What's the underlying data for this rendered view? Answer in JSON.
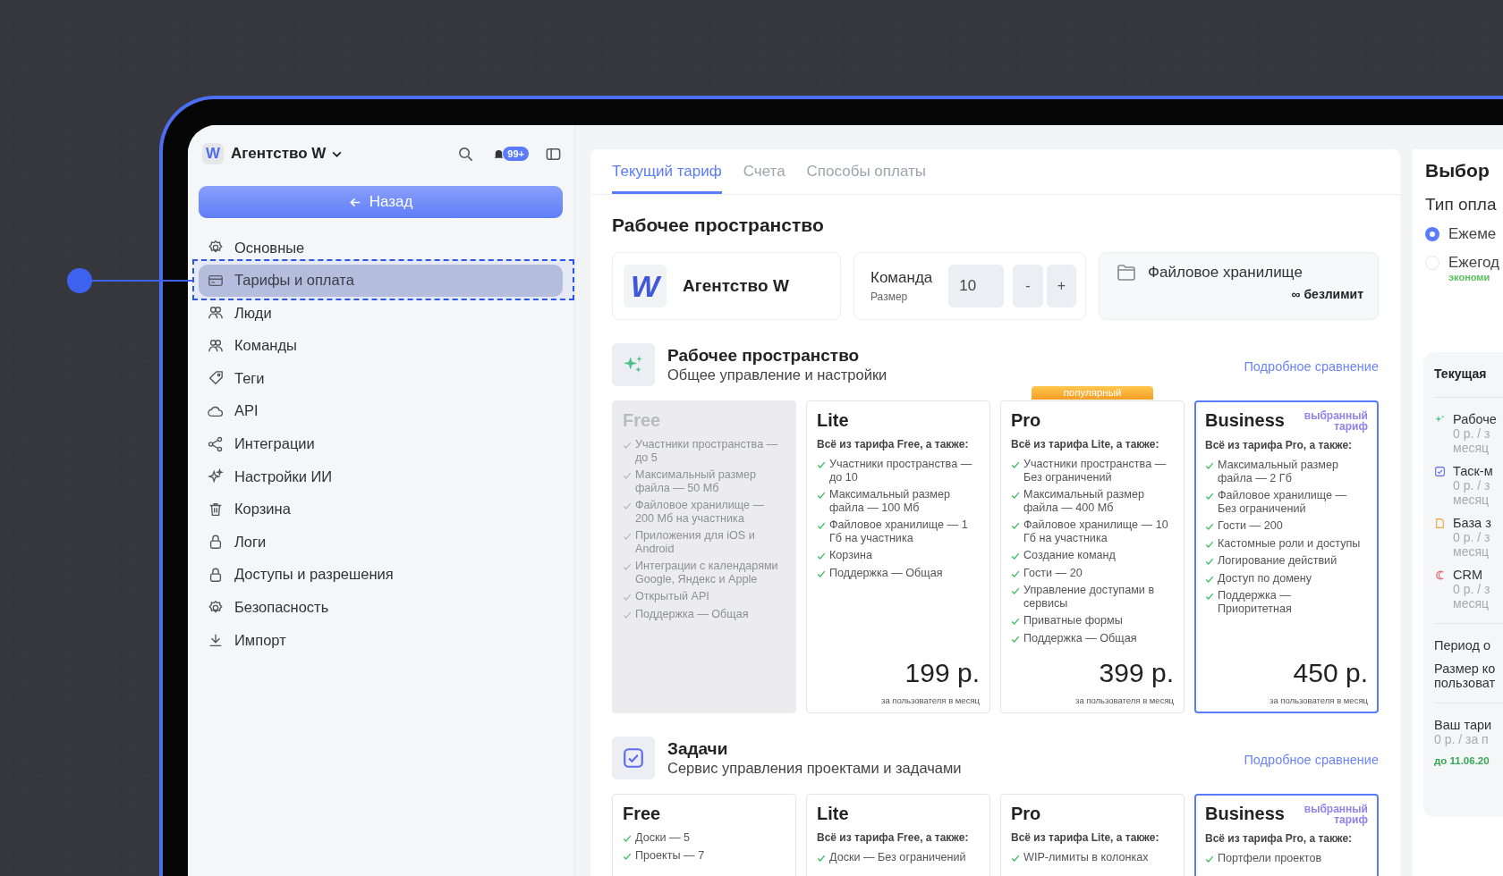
{
  "sidebar": {
    "logo": "W",
    "workspace": "Агентство W",
    "notifications": "99+",
    "back": "Назад",
    "items": [
      {
        "label": "Основные",
        "selected": false
      },
      {
        "label": "Тарифы и оплата",
        "selected": true
      },
      {
        "label": "Люди",
        "selected": false
      },
      {
        "label": "Команды",
        "selected": false
      },
      {
        "label": "Теги",
        "selected": false
      },
      {
        "label": "API",
        "selected": false
      },
      {
        "label": "Интеграции",
        "selected": false
      },
      {
        "label": "Настройки ИИ",
        "selected": false
      },
      {
        "label": "Корзина",
        "selected": false
      },
      {
        "label": "Логи",
        "selected": false
      },
      {
        "label": "Доступы и разрешения",
        "selected": false
      },
      {
        "label": "Безопасность",
        "selected": false
      },
      {
        "label": "Импорт",
        "selected": false
      }
    ]
  },
  "tabs": [
    {
      "label": "Текущий тариф",
      "selected": true
    },
    {
      "label": "Счета",
      "selected": false
    },
    {
      "label": "Способы оплаты",
      "selected": false
    }
  ],
  "workspace": {
    "heading": "Рабочее пространство",
    "logo": "W",
    "name": "Агентство W",
    "team": {
      "label": "Команда",
      "sublabel": "Размер",
      "value": "10",
      "minus": "-",
      "plus": "+"
    },
    "storage": {
      "label": "Файловое хранилище",
      "value": "∞ безлимит"
    }
  },
  "sections": [
    {
      "kind": "workspace",
      "title": "Рабочее пространство",
      "subtitle": "Общее управление и настройки",
      "link": "Подробное сравнение",
      "plans": [
        {
          "name": "Free",
          "disabled": true,
          "selected": false,
          "features": [
            "Участники пространства — до 5",
            "Максимальный размер файла — 50 Мб",
            "Файловое хранилище — 200 Мб на участника",
            "Приложения для iOS и Android",
            "Интеграции с календарями Google, Яндекс и Apple",
            "Открытый API",
            "Поддержка — Общая"
          ]
        },
        {
          "name": "Lite",
          "disabled": false,
          "selected": false,
          "subtitle": "Всё из тарифа Free, а также:",
          "features": [
            "Участники пространства — до 10",
            "Максимальный размер файла — 100 Мб",
            "Файловое хранилище — 1 Гб на участника",
            "Корзина",
            "Поддержка — Общая"
          ],
          "price": "199 р.",
          "price_note": "за пользователя в месяц"
        },
        {
          "name": "Pro",
          "disabled": false,
          "selected": false,
          "badge": "популярный",
          "subtitle": "Всё из тарифа Lite, а также:",
          "features": [
            "Участники пространства — Без ограничений",
            "Максимальный размер файла — 400 Мб",
            "Файловое хранилище — 10 Гб на участника",
            "Создание команд",
            "Гости — 20",
            "Управление доступами в сервисы",
            "Приватные формы",
            "Поддержка — Общая"
          ],
          "price": "399 р.",
          "price_note": "за пользователя в месяц"
        },
        {
          "name": "Business",
          "disabled": false,
          "selected": true,
          "selected_label": "выбранный тариф",
          "subtitle": "Всё из тарифа Pro, а также:",
          "features": [
            "Максимальный размер файла — 2 Гб",
            "Файловое хранилище — Без ограничений",
            "Гости — 200",
            "Кастомные роли и доступы",
            "Логирование действий",
            "Доступ по домену",
            "Поддержка — Приоритетная"
          ],
          "price": "450 р.",
          "price_note": "за пользователя в месяц"
        }
      ]
    },
    {
      "kind": "tasks",
      "title": "Задачи",
      "subtitle": "Сервис управления проектами и задачами",
      "link": "Подробное сравнение",
      "plans": [
        {
          "name": "Free",
          "disabled": false,
          "selected": false,
          "features": [
            "Доски — 5",
            "Проекты — 7"
          ]
        },
        {
          "name": "Lite",
          "disabled": false,
          "selected": false,
          "subtitle": "Всё из тарифа Free, а также:",
          "features": [
            "Доски — Без ограничений"
          ]
        },
        {
          "name": "Pro",
          "disabled": false,
          "selected": false,
          "subtitle": "Всё из тарифа Lite, а также:",
          "features": [
            "WIP-лимиты в колонках"
          ]
        },
        {
          "name": "Business",
          "disabled": false,
          "selected": true,
          "selected_label": "выбранный тариф",
          "subtitle": "Всё из тарифа Pro, а также:",
          "features": [
            "Портфели проектов"
          ]
        }
      ]
    }
  ],
  "right_panel": {
    "title": "Выбор",
    "payment_type": "Тип опла",
    "options": [
      {
        "label": "Ежеме",
        "selected": true
      },
      {
        "label": "Ежегод",
        "note": "экономи",
        "selected": false
      }
    ],
    "summary": {
      "title": "Текущая",
      "items": [
        {
          "kind": "workspace",
          "name": "Рабоче",
          "price": "0 р. / з",
          "period": "месяц"
        },
        {
          "kind": "tasks",
          "name": "Таск-м",
          "price": "0 р. / з",
          "period": "месяц"
        },
        {
          "kind": "docs",
          "name": "База з",
          "price": "0 р. / з",
          "period": "месяц"
        },
        {
          "kind": "crm",
          "name": "CRM",
          "price": "0 р. / з",
          "period": "месяц"
        }
      ],
      "period": "Период о",
      "team_size": "Размер ко",
      "team_size_unit": "пользоват",
      "total_label": "Ваш тари",
      "total": "0 р. / за п",
      "valid_until": "до 11.06.20"
    }
  }
}
